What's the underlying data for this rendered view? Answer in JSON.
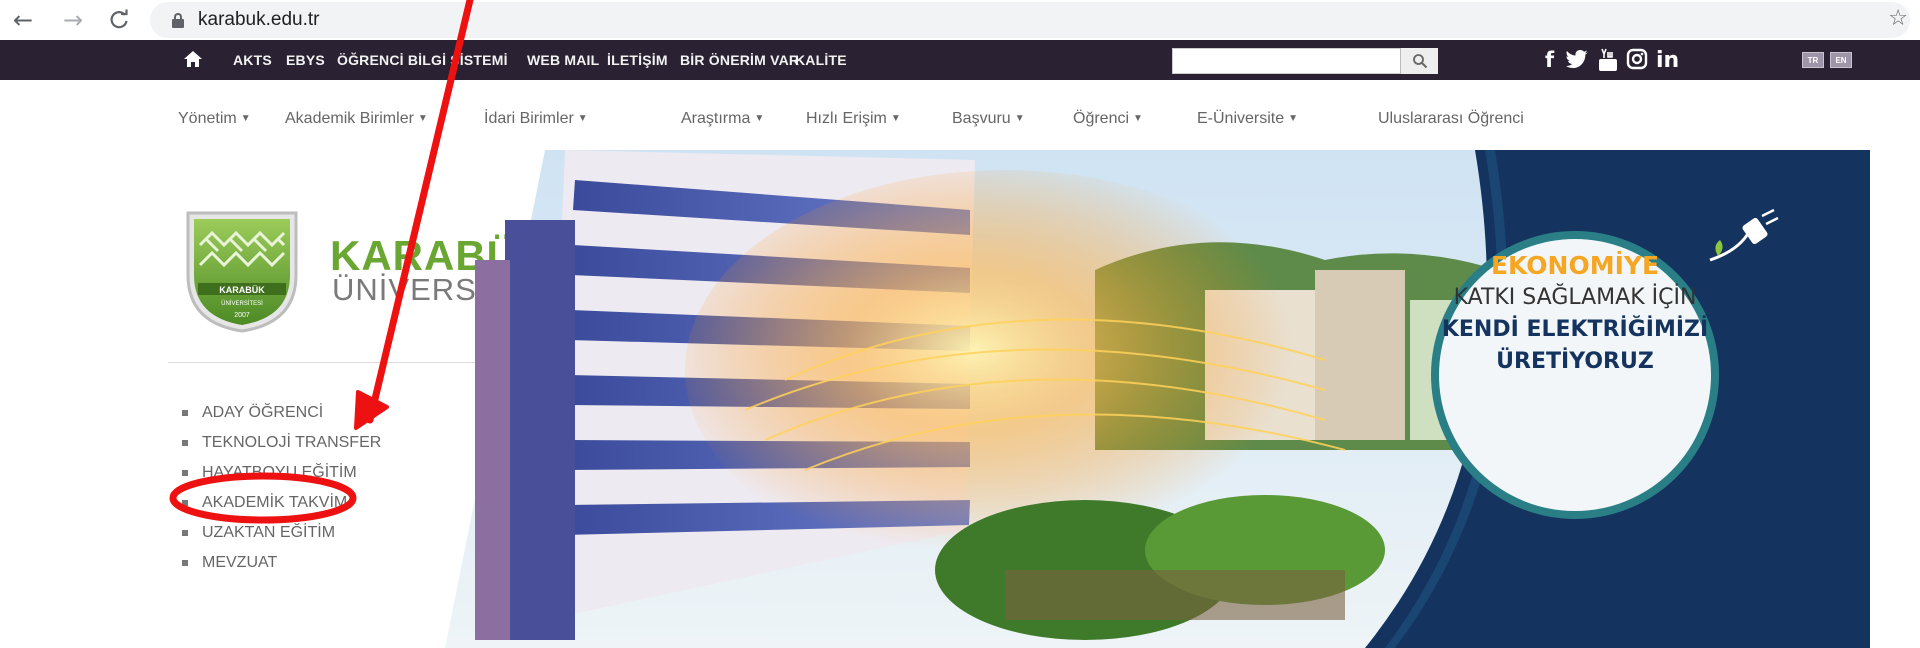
{
  "browser": {
    "url": "karabuk.edu.tr"
  },
  "topbar": {
    "links": [
      "AKTS",
      "EBYS",
      "ÖĞRENCİ BİLGİ SİSTEMİ",
      "WEB MAIL",
      "İLETİŞİM",
      "BİR ÖNERİM VAR",
      "KALİTE"
    ],
    "search_placeholder": "",
    "languages": [
      "TR",
      "EN"
    ],
    "social_icons": [
      "facebook-icon",
      "twitter-icon",
      "youtube-icon",
      "instagram-icon",
      "linkedin-icon"
    ]
  },
  "mainnav": {
    "items": [
      "Yönetim",
      "Akademik Birimler",
      "İdari Birimler",
      "Araştırma",
      "Hızlı Erişim",
      "Başvuru",
      "Öğrenci",
      "E-Üniversite",
      "Uluslararası Öğrenci"
    ]
  },
  "brand": {
    "name_top": "KARABÜK",
    "name_bottom": "ÜNİVERSİTESİ",
    "seal_text": "KARABÜK ÜNİVERSİTESİ",
    "seal_year": "2007"
  },
  "sidelinks": [
    "ADAY ÖĞRENCİ",
    "TEKNOLOJİ TRANSFER",
    "HAYATBOYU EĞİTİM",
    "AKADEMİK TAKVİM",
    "UZAKTAN EĞİTİM",
    "MEVZUAT"
  ],
  "banner": {
    "line1": "EKONOMİYE",
    "line2": "KATKI SAĞLAMAK İÇİN",
    "line3": "KENDİ ELEKTRİĞİMİZİ",
    "line4": "ÜRETİYORUZ"
  },
  "colors": {
    "topbar_bg": "#2a2233",
    "brand_green": "#6aa632",
    "banner_navy": "#14335e",
    "banner_orange": "#f5a623",
    "annotation_red": "#ee1111"
  }
}
